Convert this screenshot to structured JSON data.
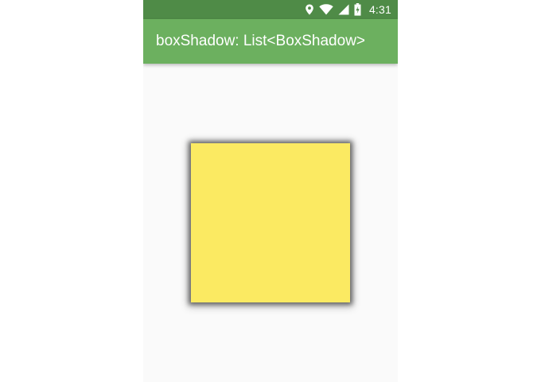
{
  "status_bar": {
    "time": "4:31",
    "icons": [
      "location-icon",
      "wifi-icon",
      "signal-icon",
      "battery-charging-icon"
    ]
  },
  "app_bar": {
    "title": "boxShadow: List<BoxShadow>"
  },
  "colors": {
    "status_bar": "#4f8b47",
    "app_bar": "#6cb05f",
    "background": "#fafafa",
    "box": "#fbea62"
  }
}
